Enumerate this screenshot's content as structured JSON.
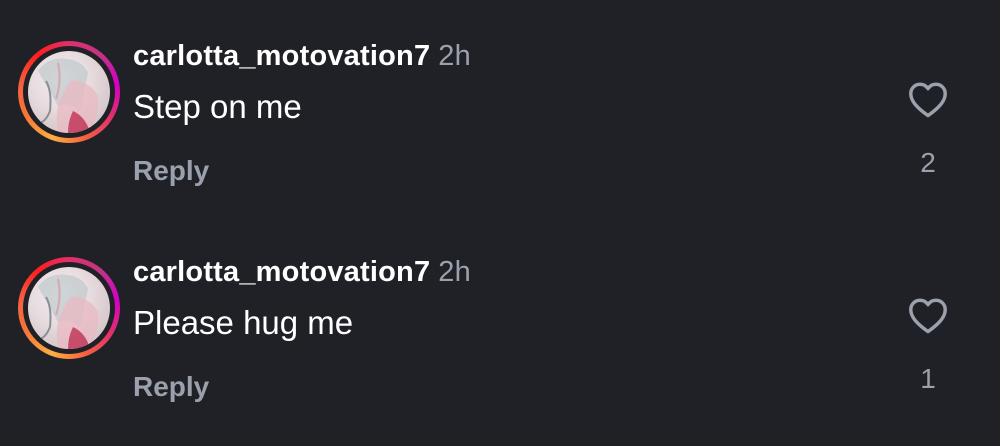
{
  "comments": [
    {
      "username": "carlotta_motovation7",
      "time": "2h",
      "text": "Step on me",
      "reply_label": "Reply",
      "likes": "2",
      "avatar_icon": "anime-character-avatar"
    },
    {
      "username": "carlotta_motovation7",
      "time": "2h",
      "text": "Please hug me",
      "reply_label": "Reply",
      "likes": "1",
      "avatar_icon": "anime-character-avatar"
    }
  ],
  "colors": {
    "background": "#202127",
    "primary_text": "#ffffff",
    "secondary_text": "#9aa0ac",
    "story_ring_gradient": [
      "#fcaf45",
      "#f77737",
      "#fd1d1d",
      "#e1306c",
      "#c13584"
    ]
  },
  "icons": {
    "like": "heart-outline-icon"
  }
}
